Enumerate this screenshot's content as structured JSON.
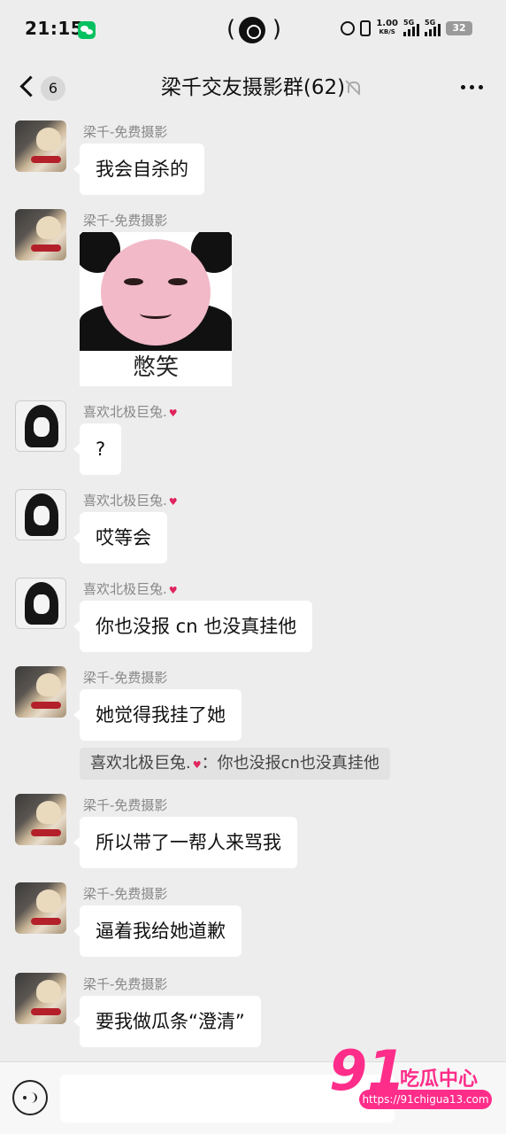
{
  "status_bar": {
    "time": "21:15",
    "net_speed_value": "1.00",
    "net_speed_unit": "KB/S",
    "signal_1_label": "5G",
    "signal_2_label": "5G",
    "battery": "32"
  },
  "nav": {
    "back_unread_count": "6",
    "title": "梁千交友摄影群(62)"
  },
  "messages": [
    {
      "sender": "梁千-免费摄影",
      "text": "我会自杀的"
    },
    {
      "sender": "梁千-免费摄影",
      "sticker_caption": "憋笑"
    },
    {
      "sender": "喜欢北极巨兔.",
      "text": "?"
    },
    {
      "sender": "喜欢北极巨兔.",
      "text": "哎等会"
    },
    {
      "sender": "喜欢北极巨兔.",
      "text": "你也没报 cn 也没真挂他"
    },
    {
      "sender": "梁千-免费摄影",
      "text": "她觉得我挂了她",
      "quote_sender": "喜欢北极巨兔.",
      "quote_text": "：你也没报cn也没真挂他"
    },
    {
      "sender": "梁千-免费摄影",
      "text": "所以带了一帮人来骂我"
    },
    {
      "sender": "梁千-免费摄影",
      "text": "逼着我给她道歉"
    },
    {
      "sender": "梁千-免费摄影",
      "text": "要我做瓜条“澄清”"
    }
  ],
  "watermark": {
    "number": "91",
    "name": "吃瓜中心",
    "url": "https://91chigua13.com"
  },
  "colors": {
    "background": "#ededed",
    "bubble": "#ffffff",
    "sender_name": "#888888",
    "heart": "#e0245e",
    "watermark": "#ff2d8a"
  },
  "icons": [
    "back-chevron-icon",
    "mute-bell-icon",
    "more-dots-icon",
    "voice-input-icon",
    "heart-emoji-icon"
  ]
}
